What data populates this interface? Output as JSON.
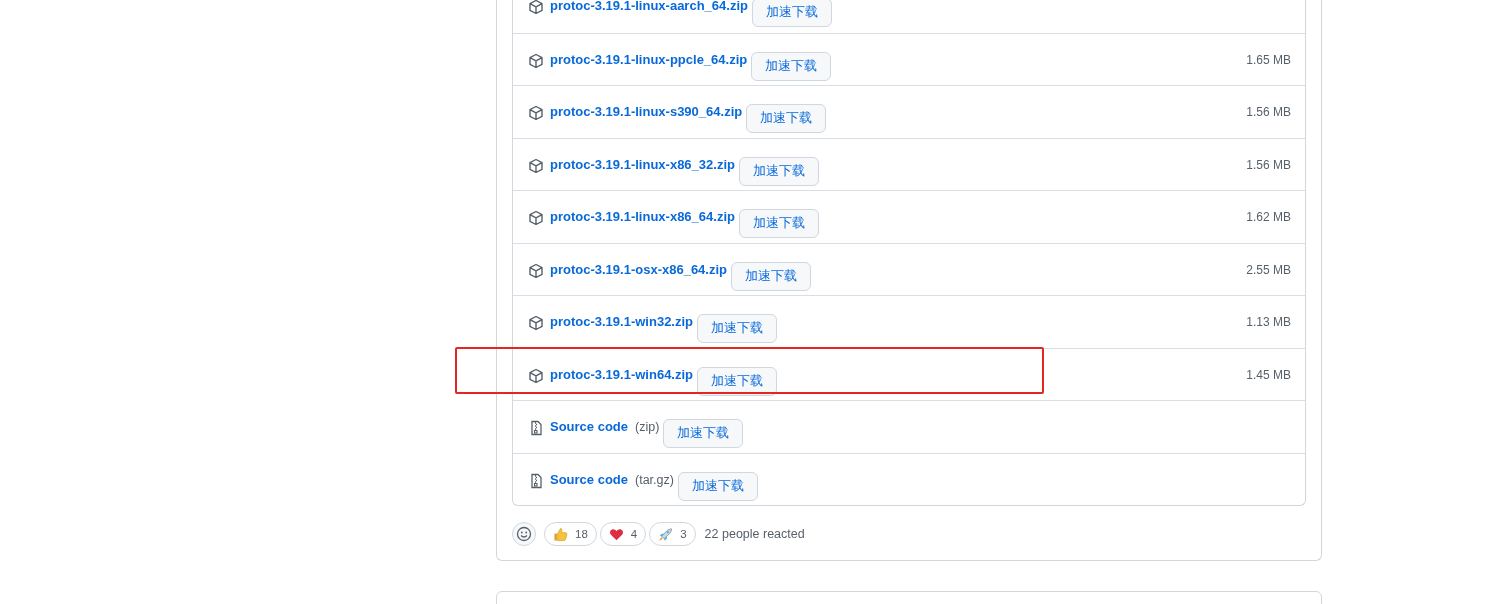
{
  "assets": [
    {
      "kind": "package",
      "name": "protoc-3.19.1-linux-aarch_64.zip",
      "button": "加速下载",
      "highlighted": false
    },
    {
      "kind": "package",
      "name": "protoc-3.19.1-linux-ppcle_64.zip",
      "button": "加速下载",
      "size": "1.65 MB",
      "highlighted": false
    },
    {
      "kind": "package",
      "name": "protoc-3.19.1-linux-s390_64.zip",
      "button": "加速下载",
      "size": "1.56 MB",
      "highlighted": false
    },
    {
      "kind": "package",
      "name": "protoc-3.19.1-linux-x86_32.zip",
      "button": "加速下载",
      "size": "1.56 MB",
      "highlighted": false
    },
    {
      "kind": "package",
      "name": "protoc-3.19.1-linux-x86_64.zip",
      "button": "加速下载",
      "size": "1.62 MB",
      "highlighted": false
    },
    {
      "kind": "package",
      "name": "protoc-3.19.1-osx-x86_64.zip",
      "button": "加速下载",
      "size": "2.55 MB",
      "highlighted": false
    },
    {
      "kind": "package",
      "name": "protoc-3.19.1-win32.zip",
      "button": "加速下载",
      "size": "1.13 MB",
      "highlighted": false
    },
    {
      "kind": "package",
      "name": "protoc-3.19.1-win64.zip",
      "button": "加速下载",
      "size": "1.45 MB",
      "highlighted": true
    },
    {
      "kind": "source",
      "name": "Source code",
      "format": "(zip)",
      "button": "加速下载",
      "highlighted": false
    },
    {
      "kind": "source",
      "name": "Source code",
      "format": "(tar.gz)",
      "button": "加速下载",
      "highlighted": false
    }
  ],
  "reactions": {
    "items": [
      {
        "kind": "thumbs_up",
        "count": "18"
      },
      {
        "kind": "heart",
        "count": "4"
      },
      {
        "kind": "rocket",
        "count": "3"
      }
    ],
    "summary": "22 people reacted"
  }
}
